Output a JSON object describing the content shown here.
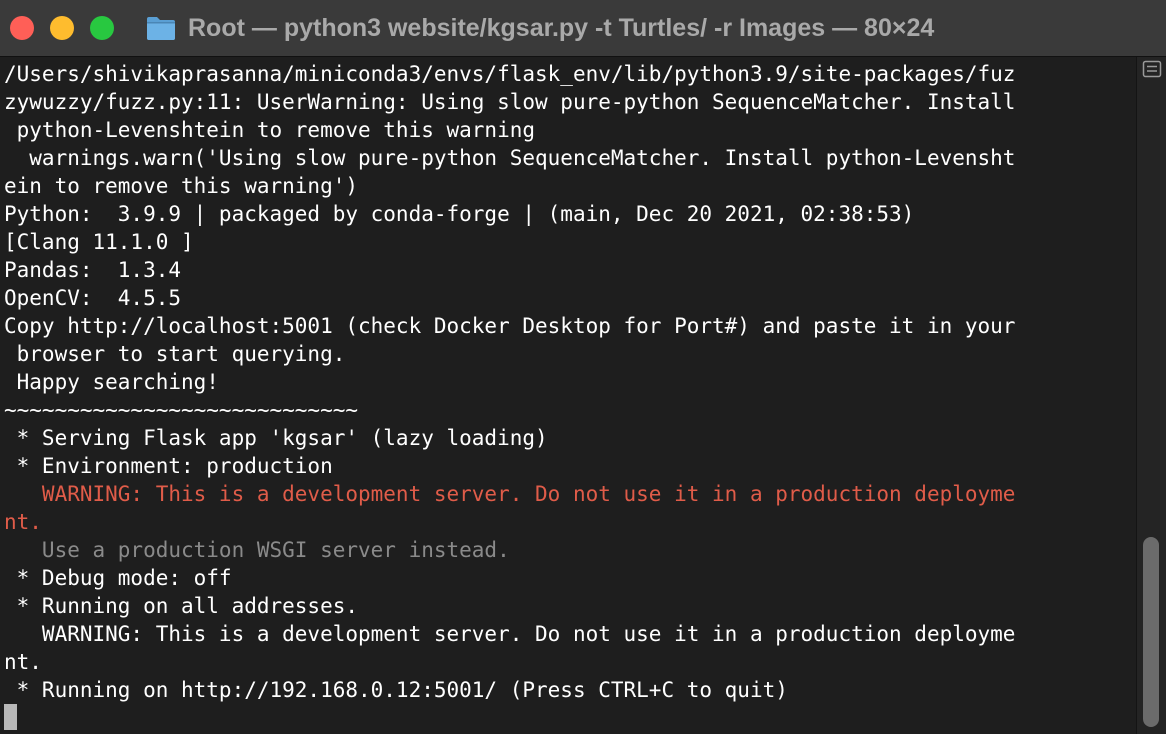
{
  "window": {
    "title": "Root — python3 website/kgsar.py -t Turtles/ -r Images — 80×24",
    "controls": {
      "close_glyph": "×",
      "minimize_glyph": "−",
      "zoom_glyph": "+"
    }
  },
  "terminal": {
    "lines": [
      {
        "text": "/Users/shivikaprasanna/miniconda3/envs/flask_env/lib/python3.9/site-packages/fuz",
        "style": "normal"
      },
      {
        "text": "zywuzzy/fuzz.py:11: UserWarning: Using slow pure-python SequenceMatcher. Install",
        "style": "normal"
      },
      {
        "text": " python-Levenshtein to remove this warning",
        "style": "normal"
      },
      {
        "text": "  warnings.warn('Using slow pure-python SequenceMatcher. Install python-Levensht",
        "style": "normal"
      },
      {
        "text": "ein to remove this warning')",
        "style": "normal"
      },
      {
        "text": "Python:  3.9.9 | packaged by conda-forge | (main, Dec 20 2021, 02:38:53)",
        "style": "normal"
      },
      {
        "text": "[Clang 11.1.0 ]",
        "style": "normal"
      },
      {
        "text": "Pandas:  1.3.4",
        "style": "normal"
      },
      {
        "text": "OpenCV:  4.5.5",
        "style": "normal"
      },
      {
        "text": "Copy http://localhost:5001 (check Docker Desktop for Port#) and paste it in your",
        "style": "normal"
      },
      {
        "text": " browser to start querying.",
        "style": "normal"
      },
      {
        "text": " Happy searching!",
        "style": "normal"
      },
      {
        "text": "~~~~~~~~~~~~~~~~~~~~~~~~~~~~",
        "style": "normal"
      },
      {
        "text": " * Serving Flask app 'kgsar' (lazy loading)",
        "style": "normal"
      },
      {
        "text": " * Environment: production",
        "style": "normal"
      },
      {
        "text": "   WARNING: This is a development server. Do not use it in a production deployme",
        "style": "warn"
      },
      {
        "text": "nt.",
        "style": "warn"
      },
      {
        "text": "   Use a production WSGI server instead.",
        "style": "dim"
      },
      {
        "text": " * Debug mode: off",
        "style": "normal"
      },
      {
        "text": " * Running on all addresses.",
        "style": "normal"
      },
      {
        "text": "   WARNING: This is a development server. Do not use it in a production deployme",
        "style": "normal"
      },
      {
        "text": "nt.",
        "style": "normal"
      },
      {
        "text": " * Running on http://192.168.0.12:5001/ (Press CTRL+C to quit)",
        "style": "normal"
      }
    ]
  },
  "colors": {
    "background": "#1e1e1e",
    "text": "#ffffff",
    "warning": "#e05c49",
    "dim": "#8a8a8a",
    "close": "#ff5f57",
    "minimize": "#febc2e",
    "zoom": "#28c840"
  },
  "icons": {
    "title": "folder-icon",
    "scrollbar": "marks-icon"
  }
}
